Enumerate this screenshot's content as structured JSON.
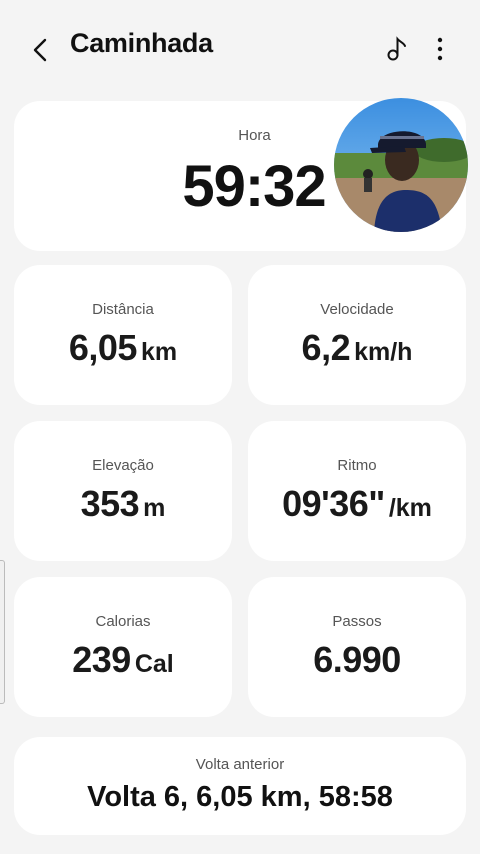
{
  "header": {
    "title": "Caminhada",
    "icons": {
      "back": "chevron-left-icon",
      "music": "music-note-icon",
      "more": "more-vertical-icon"
    }
  },
  "timer": {
    "label": "Hora",
    "value": "59:32"
  },
  "stats": [
    {
      "label": "Distância",
      "value": "6,05",
      "unit": "km"
    },
    {
      "label": "Velocidade",
      "value": "6,2",
      "unit": "km/h"
    },
    {
      "label": "Elevação",
      "value": "353",
      "unit": "m"
    },
    {
      "label": "Ritmo",
      "value": "09'36\"",
      "unit": "/km"
    },
    {
      "label": "Calorias",
      "value": "239",
      "unit": "Cal"
    },
    {
      "label": "Passos",
      "value": "6.990",
      "unit": ""
    }
  ],
  "lap": {
    "label": "Volta anterior",
    "value": "Volta 6, 6,05 km, 58:58"
  },
  "colors": {
    "background": "#f4f4f4",
    "card": "#ffffff",
    "text": "#111111",
    "label": "#555555"
  }
}
